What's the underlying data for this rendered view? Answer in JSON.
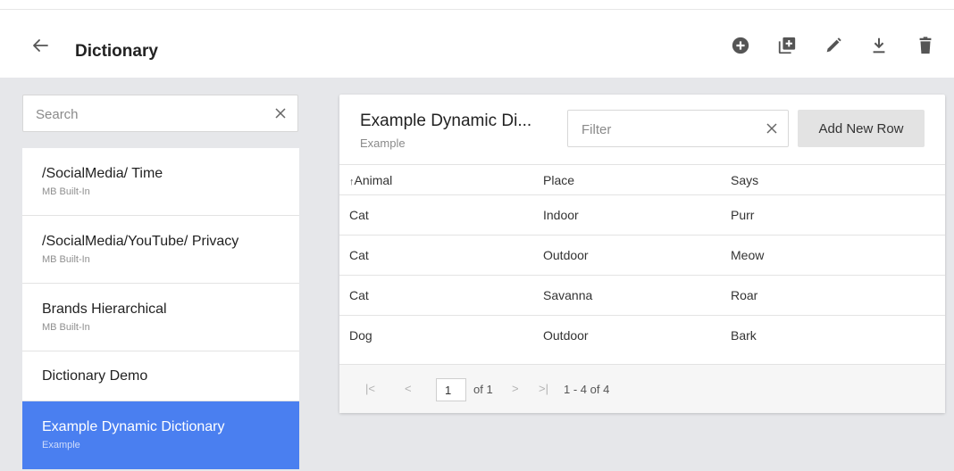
{
  "header": {
    "title": "Dictionary",
    "icons": [
      "back-arrow-icon",
      "add-circle-icon",
      "add-box-icon",
      "edit-pencil-icon",
      "download-icon",
      "delete-trash-icon"
    ]
  },
  "sidebar": {
    "search": {
      "placeholder": "Search",
      "value": ""
    },
    "items": [
      {
        "name": "/SocialMedia/ Time",
        "sub": "MB Built-In"
      },
      {
        "name": "/SocialMedia/YouTube/ Privacy",
        "sub": "MB Built-In"
      },
      {
        "name": "Brands Hierarchical",
        "sub": "MB Built-In"
      },
      {
        "name": "Dictionary Demo",
        "sub": ""
      },
      {
        "name": "Example Dynamic Dictionary",
        "sub": "Example",
        "selected": true
      }
    ]
  },
  "panel": {
    "title": "Example Dynamic Di...",
    "subtitle": "Example",
    "filter_placeholder": "Filter",
    "add_button_label": "Add New Row",
    "sort_indicator": "↑",
    "columns": [
      "Animal",
      "Place",
      "Says"
    ],
    "rows": [
      [
        "Cat",
        "Indoor",
        "Purr"
      ],
      [
        "Cat",
        "Outdoor",
        "Meow"
      ],
      [
        "Cat",
        "Savanna",
        "Roar"
      ],
      [
        "Dog",
        "Outdoor",
        "Bark"
      ]
    ],
    "pager": {
      "first": "|<",
      "prev": "<",
      "page": "1",
      "of": "of 1",
      "next": ">",
      "last": ">|",
      "range": "1 - 4 of 4"
    }
  },
  "colors": {
    "accent": "#4a7ff0",
    "background": "#e6e7ea",
    "icon": "#555555"
  }
}
